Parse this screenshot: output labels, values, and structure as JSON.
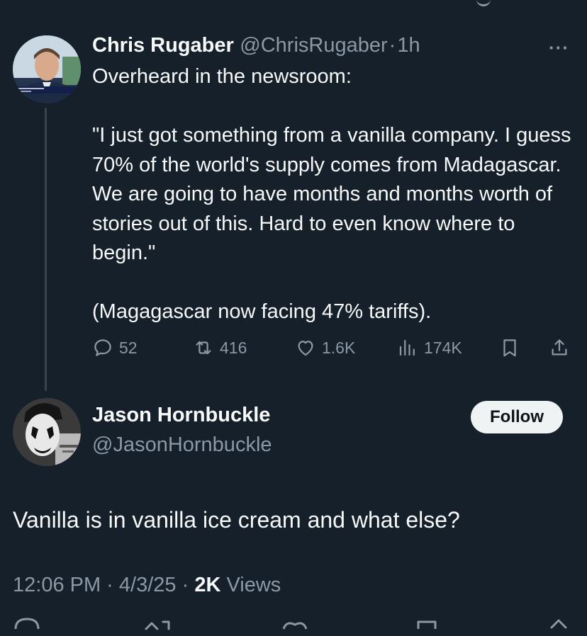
{
  "tweet1": {
    "name": "Chris Rugaber",
    "handle": "@ChrisRugaber",
    "separator": "·",
    "time": "1h",
    "more": "···",
    "text": "Overheard in the newsroom:\n\n\"I just got something from a vanilla company. I guess 70% of the world's supply comes from Madagascar. We are going to have months and months worth of stories out of this. Hard to even know where to begin.\"\n\n(Magagascar now facing 47% tariffs).",
    "actions": {
      "replies": "52",
      "reposts": "416",
      "likes": "1.6K",
      "views": "174K"
    }
  },
  "tweet2": {
    "name": "Jason Hornbuckle",
    "handle": "@JasonHornbuckle",
    "follow_label": "Follow",
    "text": "Vanilla is in vanilla ice cream and what else?",
    "timestamp": "12:06 PM · 4/3/25 · ",
    "views_count": "2K",
    "views_label": " Views"
  },
  "colors": {
    "background": "#15202b",
    "text": "#f7f9f9",
    "muted": "#8b98a5",
    "thread_line": "#38444d",
    "follow_bg": "#eff3f4"
  }
}
